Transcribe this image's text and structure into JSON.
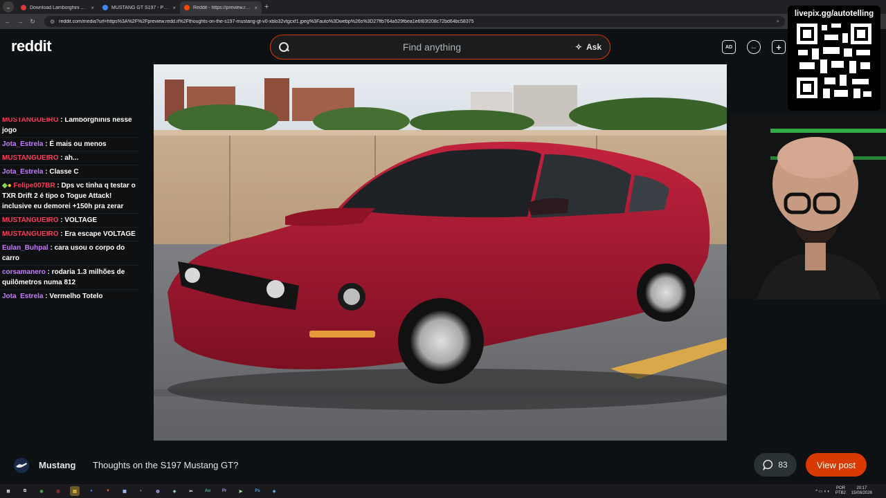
{
  "browser": {
    "menu_glyph": "⌄",
    "tabs": [
      {
        "label": "Download Lamborghini Aventa...",
        "favicon_color": "#d93a3a",
        "active": false
      },
      {
        "label": "MUSTANG GT S197 - Pesquisa...",
        "favicon_color": "#4285f4",
        "active": false
      },
      {
        "label": "Reddit - https://preview.redd.it...",
        "favicon_color": "#ff4500",
        "active": true
      }
    ],
    "close_glyph": "×",
    "new_tab_glyph": "+",
    "back_glyph": "←",
    "forward_glyph": "→",
    "reload_glyph": "↻",
    "tune_glyph": "⚙",
    "url": "reddit.com/media?url=https%3A%2F%2Fpreview.redd.it%2Fthoughts-on-the-s197-mustang-gt-v0-xblo32vtgcxf1.jpeg%3Fauto%3Dwebp%26s%3D27ffb764a529fbea1e6f83f208c72bd64bc58375",
    "zoom_glyph": "⌕"
  },
  "header": {
    "logo": "reddit",
    "search_placeholder": "Find anything",
    "ask_label": "Ask",
    "ask_glyph": "✧",
    "icons": [
      {
        "name": "advertise-icon",
        "glyph": "AD"
      },
      {
        "name": "chat-icon",
        "glyph": "…"
      },
      {
        "name": "create-post-icon",
        "glyph": "+"
      }
    ]
  },
  "overlay": {
    "qr_caption": "livepix.gg/autotelling"
  },
  "chat": {
    "messages": [
      {
        "user": "MUSTANGUEIRO",
        "color": "#ff3b5c",
        "text": "Lamborghinis nesse jogo"
      },
      {
        "user": "Jota_Estrela",
        "color": "#c77dff",
        "text": "É mais ou menos"
      },
      {
        "user": "MUSTANGUEIRO",
        "color": "#ff3b5c",
        "text": "ah..."
      },
      {
        "user": "Jota_Estrela",
        "color": "#c77dff",
        "text": "Classe C"
      },
      {
        "user": "Felipe007BR",
        "color": "#ff3b5c",
        "text": "Dps vc tinha q testar o TXR Drift 2 é tipo o Togue Attack! inclusive eu demorei +150h pra zerar"
      },
      {
        "user": "MUSTANGUEIRO",
        "color": "#ff3b5c",
        "text": "VOLTAGE"
      },
      {
        "user": "MUSTANGUEIRO",
        "color": "#ff3b5c",
        "text": "Era escape VOLTAGE"
      },
      {
        "user": "Eulan_Buhpal",
        "color": "#c77dff",
        "text": "cara usou o corpo do carro"
      },
      {
        "user": "corsamanero",
        "color": "#c77dff",
        "text": "rodaria 1.3 milhões de quilômetros numa 812"
      },
      {
        "user": "Jota_Estrela",
        "color": "#c77dff",
        "text": "Vermelho Totelo"
      }
    ]
  },
  "post": {
    "subreddit": "Mustang",
    "title": "Thoughts on the S197 Mustang GT?",
    "comment_count": "83",
    "view_post_label": "View post"
  },
  "taskbar": {
    "apps": [
      {
        "name": "windows-start-icon",
        "glyph": "⊞",
        "color": "#ffffff"
      },
      {
        "name": "task-view-icon",
        "glyph": "⧉",
        "color": "#cccccc"
      },
      {
        "name": "app-icon-1",
        "glyph": "◉",
        "color": "#4caf50"
      },
      {
        "name": "app-icon-2",
        "glyph": "◎",
        "color": "#e53935"
      },
      {
        "name": "file-explorer-icon",
        "glyph": "▤",
        "color": "#f6c343"
      },
      {
        "name": "chrome-icon",
        "glyph": "●",
        "color": "#4285f4"
      },
      {
        "name": "brave-icon",
        "glyph": "▼",
        "color": "#fb542b"
      },
      {
        "name": "notepad-icon",
        "glyph": "▦",
        "color": "#9ec7ff"
      },
      {
        "name": "app-icon-3",
        "glyph": "◐",
        "color": "#29b6f6"
      },
      {
        "name": "obs-icon",
        "glyph": "◍",
        "color": "#b0b0ff"
      },
      {
        "name": "app-icon-4",
        "glyph": "◆",
        "color": "#80cbc4"
      },
      {
        "name": "capcut-icon",
        "glyph": "✂",
        "color": "#ffffff"
      },
      {
        "name": "audition-icon",
        "glyph": "Au",
        "color": "#29c4a9"
      },
      {
        "name": "premiere-icon",
        "glyph": "Pr",
        "color": "#9999ff"
      },
      {
        "name": "app-icon-5",
        "glyph": "▶",
        "color": "#a5d6a7"
      },
      {
        "name": "photoshop-icon",
        "glyph": "Ps",
        "color": "#31a8ff"
      },
      {
        "name": "app-icon-6",
        "glyph": "◈",
        "color": "#64b5f6"
      }
    ],
    "tray_lang_top": "POR",
    "tray_lang_bottom": "PTB2",
    "time": "20:17",
    "date": "15/08/2026",
    "tray_glyphs": "^ ▭ ◖ ◐"
  }
}
